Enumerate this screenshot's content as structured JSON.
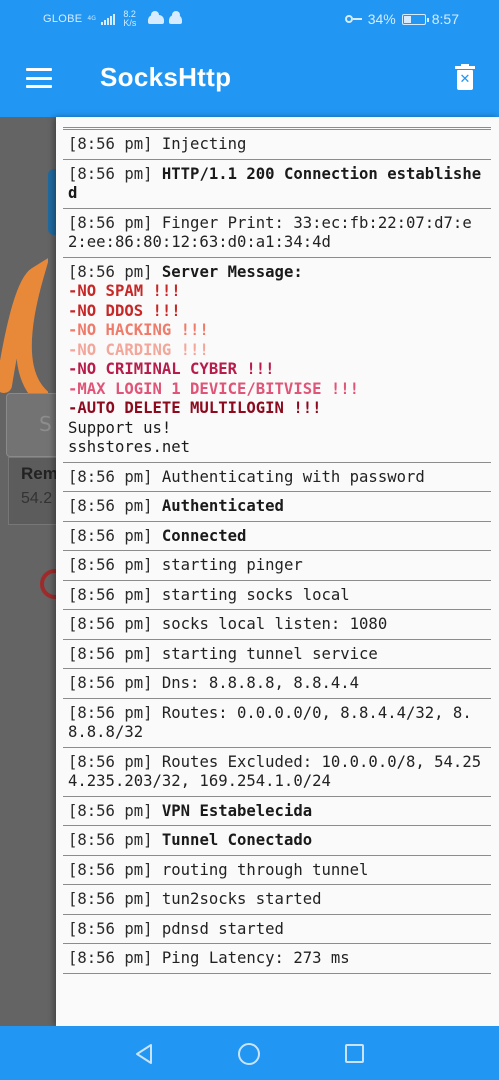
{
  "status_bar": {
    "carrier": "GLOBE",
    "network_type": "4G",
    "speed_value": "8.2",
    "speed_unit": "K/s",
    "battery_percent": "34%",
    "battery_level": 0.34,
    "time": "8:57"
  },
  "app_bar": {
    "title": "SocksHttp",
    "menu_icon": "hamburger-menu-icon",
    "clear_icon": "trash-clear-icon"
  },
  "background": {
    "card_label_1": "Rem",
    "card_label_2": "54.2",
    "search_glyph": "S"
  },
  "log": {
    "entries": [
      {
        "time": "",
        "msg": ""
      },
      {
        "time": "[8:56 pm]",
        "msg": "Injecting",
        "bold": false
      },
      {
        "time": "[8:56 pm]",
        "msg": "HTTP/1.1 200 Connection established",
        "bold": true
      },
      {
        "time": "[8:56 pm]",
        "msg": "Finger Print: 33:ec:fb:22:07:d7:e2:ee:86:80:12:63:d0:a1:34:4d",
        "bold": false
      },
      {
        "time": "[8:56 pm]",
        "msg": "Server Message:",
        "bold": true
      },
      {
        "time": "[8:56 pm]",
        "msg": "Authenticating with password",
        "bold": false
      },
      {
        "time": "[8:56 pm]",
        "msg": "Authenticated",
        "bold": true
      },
      {
        "time": "[8:56 pm]",
        "msg": "Connected",
        "bold": true
      },
      {
        "time": "[8:56 pm]",
        "msg": "starting pinger",
        "bold": false
      },
      {
        "time": "[8:56 pm]",
        "msg": "starting socks local",
        "bold": false
      },
      {
        "time": "[8:56 pm]",
        "msg": "socks local listen: 1080",
        "bold": false
      },
      {
        "time": "[8:56 pm]",
        "msg": "starting tunnel service",
        "bold": false
      },
      {
        "time": "[8:56 pm]",
        "msg": "Dns: 8.8.8.8, 8.8.4.4",
        "bold": false
      },
      {
        "time": "[8:56 pm]",
        "msg": "Routes: 0.0.0.0/0, 8.8.4.4/32, 8.8.8.8/32",
        "bold": false
      },
      {
        "time": "[8:56 pm]",
        "msg": "Routes Excluded: 10.0.0.0/8, 54.254.235.203/32, 169.254.1.0/24",
        "bold": false
      },
      {
        "time": "[8:56 pm]",
        "msg": "VPN Estabelecida",
        "bold": true
      },
      {
        "time": "[8:56 pm]",
        "msg": "Tunnel Conectado",
        "bold": true
      },
      {
        "time": "[8:56 pm]",
        "msg": "routing through tunnel",
        "bold": false
      },
      {
        "time": "[8:56 pm]",
        "msg": "tun2socks started",
        "bold": false
      },
      {
        "time": "[8:56 pm]",
        "msg": "pdnsd started",
        "bold": false
      },
      {
        "time": "[8:56 pm]",
        "msg": "Ping Latency: 273 ms",
        "bold": false
      }
    ],
    "server_message_lines": [
      {
        "text": "-NO SPAM !!!",
        "color": "#c62828"
      },
      {
        "text": "-NO DDOS !!!",
        "color": "#c62828"
      },
      {
        "text": "-NO HACKING !!!",
        "color": "#ef7b6b"
      },
      {
        "text": "-NO CARDING !!!",
        "color": "#f3a79b"
      },
      {
        "text": "-NO CRIMINAL CYBER !!!",
        "color": "#b71c4a"
      },
      {
        "text": "-MAX LOGIN 1 DEVICE/BITVISE !!!",
        "color": "#e05577"
      },
      {
        "text": "-AUTO DELETE MULTILOGIN !!!",
        "color": "#8b0a1e"
      }
    ],
    "server_message_footer": [
      "Support us!",
      "sshstores.net"
    ]
  },
  "nav_bar": {
    "back_icon": "back-triangle-icon",
    "home_icon": "home-circle-icon",
    "recents_icon": "recents-square-icon"
  },
  "colors": {
    "primary": "#2196f3",
    "panel_bg": "#fafafa",
    "dim_overlay": "#5f5f5f"
  }
}
